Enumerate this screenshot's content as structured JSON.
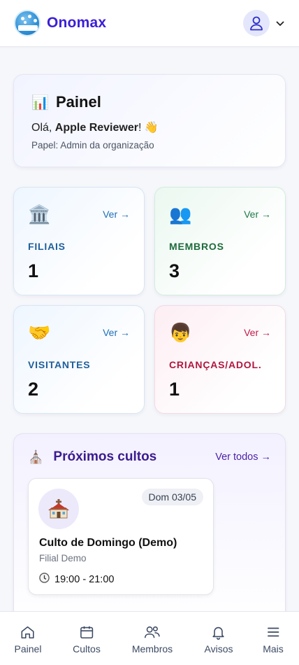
{
  "header": {
    "brand": "Onomax"
  },
  "painel": {
    "icon": "📊",
    "title": "Painel",
    "greeting_prefix": "Olá, ",
    "user_name": "Apple Reviewer",
    "greeting_suffix": "! 👋",
    "role": "Papel: Admin da organização"
  },
  "stats": [
    {
      "emoji": "🏛️",
      "link": "Ver →",
      "label": "FILIAIS",
      "value": "1",
      "color": "#1f5f9a",
      "link_color": "#1f6fb5"
    },
    {
      "emoji": "👥",
      "link": "Ver →",
      "label": "MEMBROS",
      "value": "3",
      "color": "#1d6b3c",
      "link_color": "#1f7a45"
    },
    {
      "emoji": "🤝",
      "link": "Ver →",
      "label": "VISITANTES",
      "value": "2",
      "color": "#1f5f9a",
      "link_color": "#1f6fb5"
    },
    {
      "emoji": "👦",
      "link": "Ver →",
      "label": "CRIANÇAS/ADOL.",
      "value": "1",
      "color": "#b0173f",
      "link_color": "#c01b4a"
    }
  ],
  "cultos": {
    "icon": "⛪",
    "title": "Próximos cultos",
    "link": "Ver todos →",
    "events": [
      {
        "date": "Dom 03/05",
        "name": "Culto de Domingo (Demo)",
        "branch": "Filial Demo",
        "time": "19:00 - 21:00"
      }
    ]
  },
  "nav": [
    {
      "label": "Painel",
      "icon": "home-icon"
    },
    {
      "label": "Cultos",
      "icon": "calendar-icon"
    },
    {
      "label": "Membros",
      "icon": "users-icon"
    },
    {
      "label": "Avisos",
      "icon": "bell-icon"
    },
    {
      "label": "Mais",
      "icon": "menu-icon"
    }
  ],
  "colors": {
    "brand": "#3b1fd6",
    "cultos_title": "#3b1b8f",
    "nav_text": "#3c4a63"
  }
}
